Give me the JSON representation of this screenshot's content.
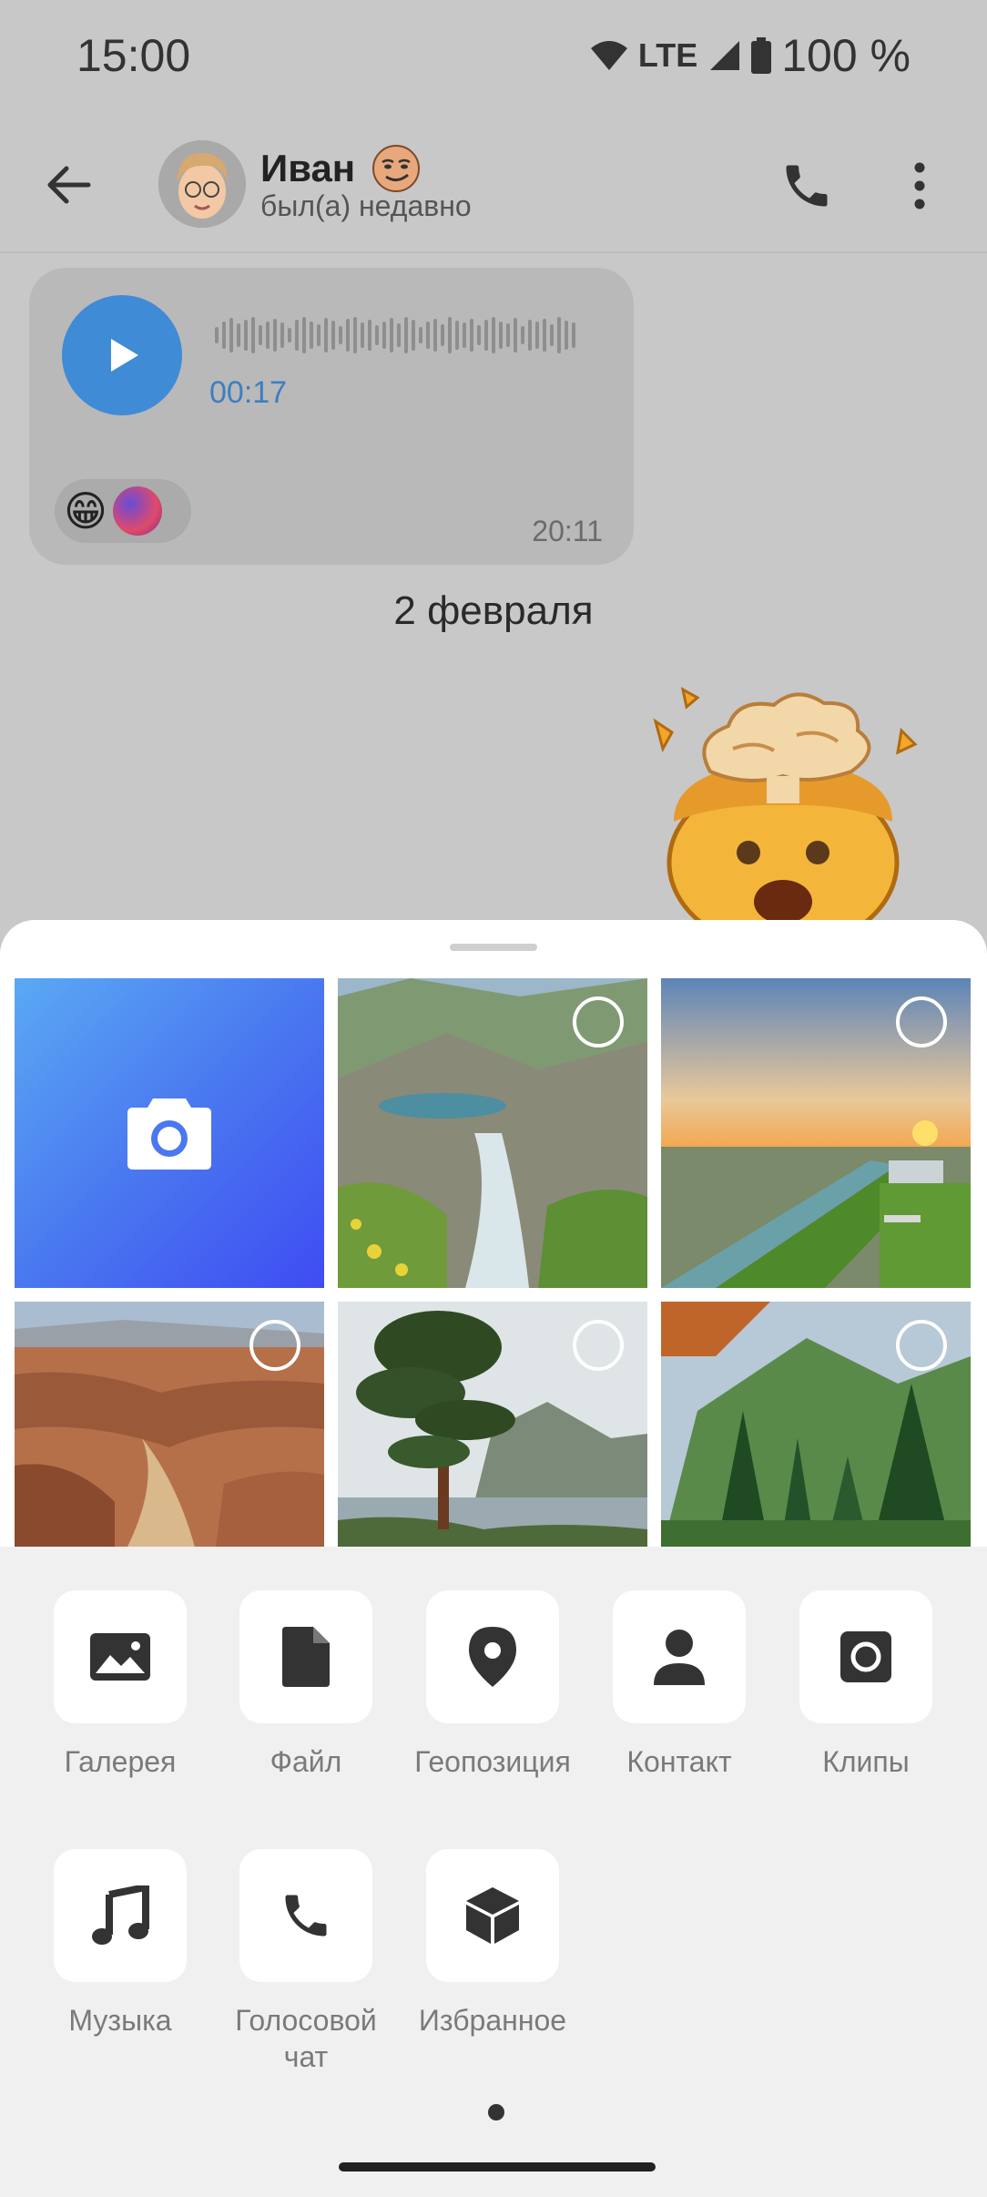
{
  "status_bar": {
    "time": "15:00",
    "network": "LTE",
    "battery": "100 %"
  },
  "header": {
    "contact_name": "Иван",
    "contact_status": "был(а) недавно"
  },
  "message": {
    "duration": "00:17",
    "reaction_emoji": "😁",
    "time": "20:11"
  },
  "date_separator": "2 февраля",
  "sticker": "exploding-head",
  "gallery": {
    "photos": [
      {
        "name": "mountain-river"
      },
      {
        "name": "sunset-canal"
      },
      {
        "name": "canyon"
      },
      {
        "name": "pine-tree-lake"
      },
      {
        "name": "forest-mountain"
      }
    ]
  },
  "actions": [
    {
      "label": "Галерея",
      "icon": "image-icon"
    },
    {
      "label": "Файл",
      "icon": "file-icon"
    },
    {
      "label": "Геопозиция",
      "icon": "location-icon"
    },
    {
      "label": "Контакт",
      "icon": "person-icon"
    },
    {
      "label": "Клипы",
      "icon": "camera-icon"
    },
    {
      "label": "Музыка",
      "icon": "music-icon"
    },
    {
      "label": "Голосовой чат",
      "icon": "phone-icon"
    },
    {
      "label": "Избранное",
      "icon": "cube-icon"
    }
  ],
  "colors": {
    "accent": "#3f8bd6",
    "dimmed_background": "#c8c8c8",
    "sheet_background": "#ffffff",
    "actions_background": "#f0f0f0"
  }
}
